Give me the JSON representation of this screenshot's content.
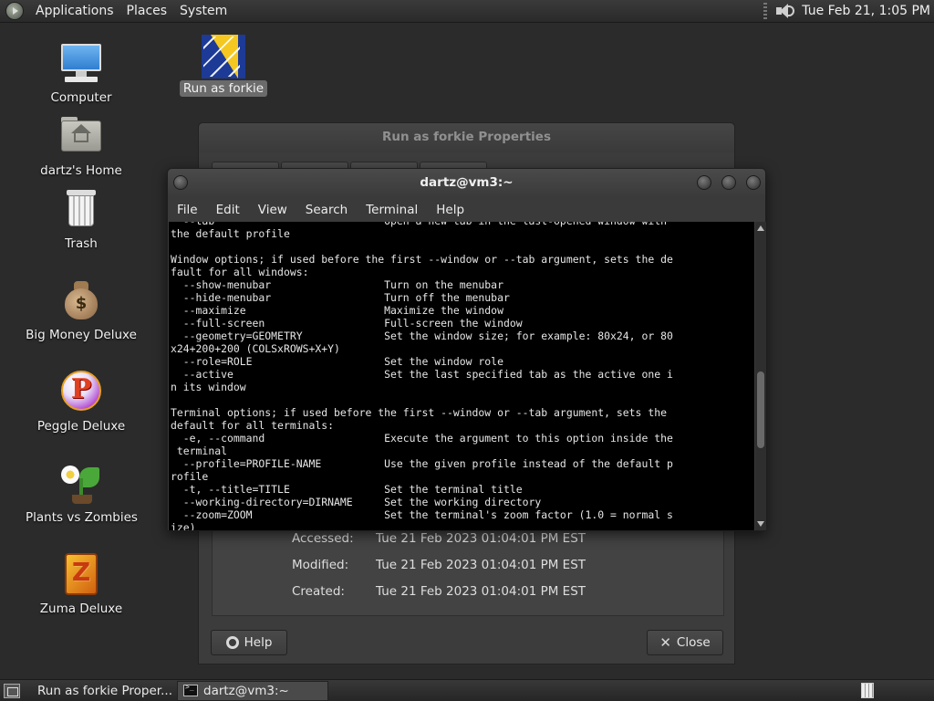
{
  "top_panel": {
    "menus": [
      "Applications",
      "Places",
      "System"
    ],
    "clock": "Tue Feb 21,  1:05 PM"
  },
  "desktop": {
    "icons": [
      {
        "label": "Computer",
        "icon": "computer-icon"
      },
      {
        "label": "dartz's Home",
        "icon": "home-folder-icon"
      },
      {
        "label": "Trash",
        "icon": "trash-icon"
      },
      {
        "label": "Big Money Deluxe",
        "icon": "money-bag-icon"
      },
      {
        "label": "Peggle Deluxe",
        "icon": "peggle-icon"
      },
      {
        "label": "Plants vs Zombies",
        "icon": "plants-vs-zombies-icon"
      },
      {
        "label": "Zuma Deluxe",
        "icon": "zuma-icon"
      },
      {
        "label": "Run as forkie",
        "icon": "run-as-forkie-icon",
        "selected": true
      }
    ]
  },
  "properties_window": {
    "title": "Run as forkie Properties",
    "rows": [
      {
        "key": "Accessed:",
        "value": "Tue 21 Feb 2023 01:04:01 PM EST"
      },
      {
        "key": "Modified:",
        "value": "Tue 21 Feb 2023 01:04:01 PM EST"
      },
      {
        "key": "Created:",
        "value": "Tue 21 Feb 2023 01:04:01 PM EST"
      }
    ],
    "help_label": "Help",
    "close_label": "Close"
  },
  "terminal_window": {
    "title": "dartz@vm3:~",
    "menus": [
      "File",
      "Edit",
      "View",
      "Search",
      "Terminal",
      "Help"
    ],
    "lines": [
      "  --tab                           Open a new tab in the last-opened window with",
      "the default profile",
      "",
      "Window options; if used before the first --window or --tab argument, sets the de",
      "fault for all windows:",
      "  --show-menubar                  Turn on the menubar",
      "  --hide-menubar                  Turn off the menubar",
      "  --maximize                      Maximize the window",
      "  --full-screen                   Full-screen the window",
      "  --geometry=GEOMETRY             Set the window size; for example: 80x24, or 80",
      "x24+200+200 (COLSxROWS+X+Y)",
      "  --role=ROLE                     Set the window role",
      "  --active                        Set the last specified tab as the active one i",
      "n its window",
      "",
      "Terminal options; if used before the first --window or --tab argument, sets the",
      "default for all terminals:",
      "  -e, --command                   Execute the argument to this option inside the",
      " terminal",
      "  --profile=PROFILE-NAME          Use the given profile instead of the default p",
      "rofile",
      "  -t, --title=TITLE               Set the terminal title",
      "  --working-directory=DIRNAME     Set the working directory",
      "  --zoom=ZOOM                     Set the terminal's zoom factor (1.0 = normal s",
      "ize)"
    ]
  },
  "taskbar": {
    "tasks": [
      {
        "label": "Run as forkie Proper...",
        "icon": "run-as-forkie-icon",
        "active": false
      },
      {
        "label": "dartz@vm3:~",
        "icon": "terminal-icon",
        "active": true
      }
    ]
  }
}
